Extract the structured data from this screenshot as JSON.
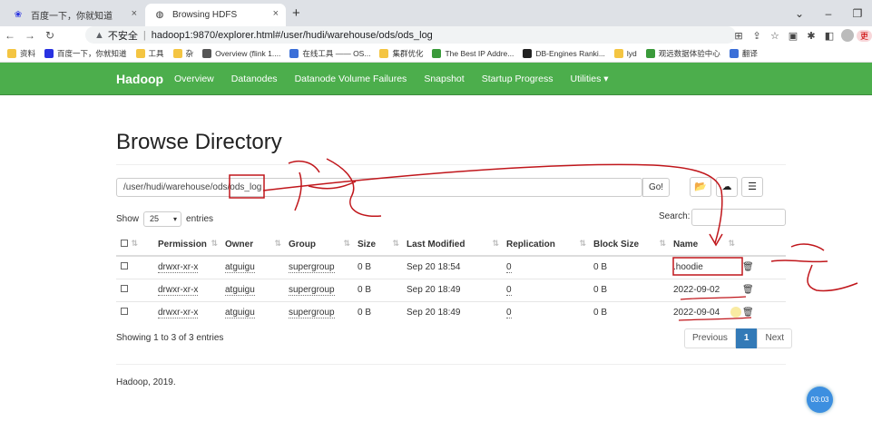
{
  "browser": {
    "tabs": [
      {
        "title": "百度一下，你就知道"
      },
      {
        "title": "Browsing HDFS"
      }
    ],
    "url_warning": "不安全",
    "url": "hadoop1:9870/explorer.html#/user/hudi/warehouse/ods/ods_log",
    "profile_label": "更",
    "bookmarks": [
      "资料",
      "百度一下，你就知道",
      "工具",
      "杂",
      "Overview (flink 1....",
      "在线工具 —— OS...",
      "集群优化",
      "The Best IP Addre...",
      "DB-Engines Ranki...",
      "lyd",
      "观远数据体验中心",
      "翻译"
    ]
  },
  "navbar": {
    "brand": "Hadoop",
    "links": [
      "Overview",
      "Datanodes",
      "Datanode Volume Failures",
      "Snapshot",
      "Startup Progress",
      "Utilities ▾"
    ]
  },
  "page": {
    "title": "Browse Directory",
    "path": "/user/hudi/warehouse/ods/ods_log",
    "go_label": "Go!",
    "show_label": "Show",
    "show_value": "25",
    "entries_label": "entries",
    "search_label": "Search:",
    "columns": [
      "Permission",
      "Owner",
      "Group",
      "Size",
      "Last Modified",
      "Replication",
      "Block Size",
      "Name"
    ],
    "rows": [
      {
        "permission": "drwxr-xr-x",
        "owner": "atguigu",
        "group": "supergroup",
        "size": "0 B",
        "modified": "Sep 20 18:54",
        "replication": "0",
        "block_size": "0 B",
        "name": ".hoodie"
      },
      {
        "permission": "drwxr-xr-x",
        "owner": "atguigu",
        "group": "supergroup",
        "size": "0 B",
        "modified": "Sep 20 18:49",
        "replication": "0",
        "block_size": "0 B",
        "name": "2022-09-02"
      },
      {
        "permission": "drwxr-xr-x",
        "owner": "atguigu",
        "group": "supergroup",
        "size": "0 B",
        "modified": "Sep 20 18:49",
        "replication": "0",
        "block_size": "0 B",
        "name": "2022-09-04"
      }
    ],
    "showing": "Showing 1 to 3 of 3 entries",
    "pager": {
      "prev": "Previous",
      "current": "1",
      "next": "Next"
    },
    "footer": "Hadoop, 2019."
  },
  "overlay": {
    "timer": "03:03"
  },
  "colors": {
    "navbar": "#4cae4c",
    "annotation": "#c0161b",
    "pager_active": "#337ab7"
  }
}
